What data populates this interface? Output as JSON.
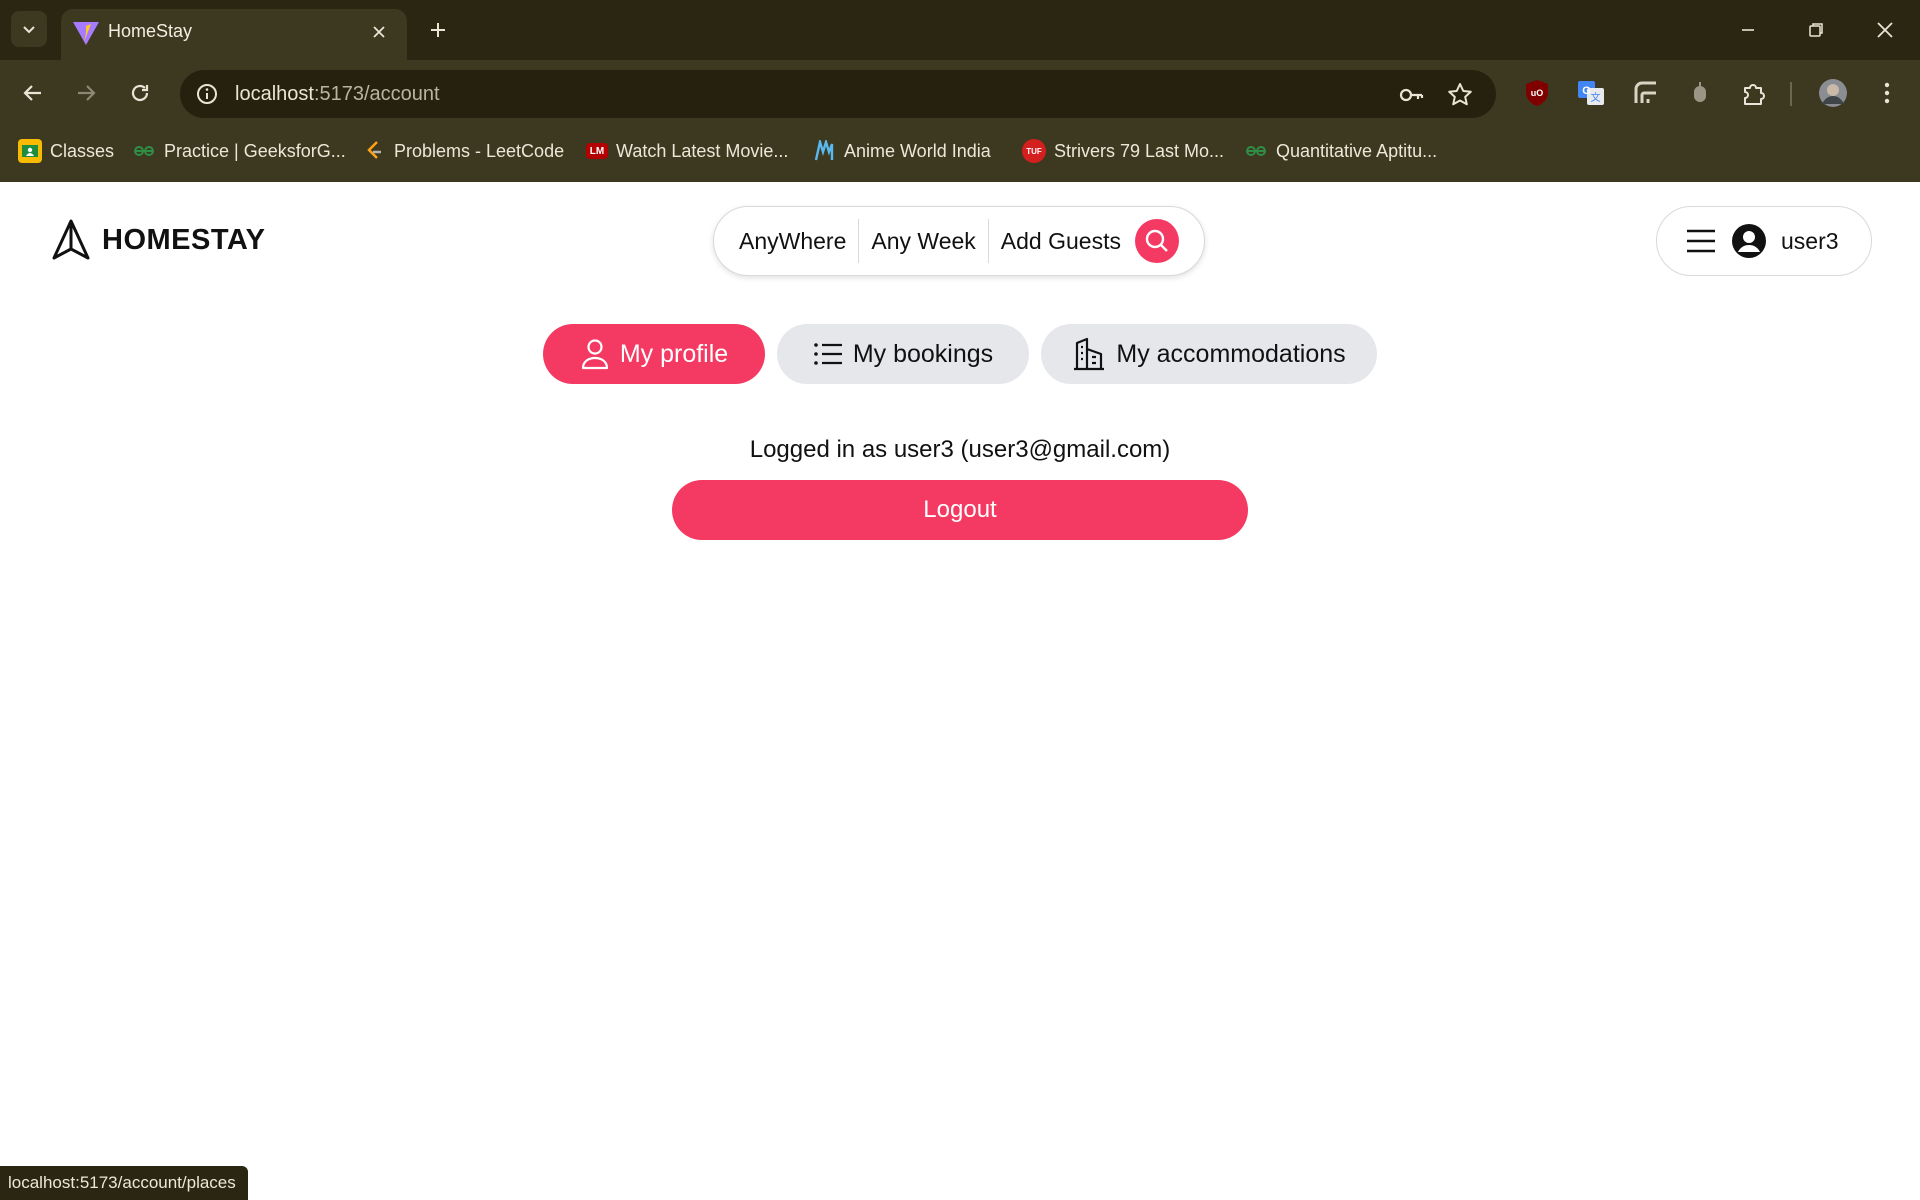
{
  "browser": {
    "tab": {
      "title": "HomeStay"
    },
    "url": {
      "host": "localhost",
      "rest": ":5173/account"
    },
    "bookmarks": [
      {
        "label": "Classes",
        "icon": "classroom-icon"
      },
      {
        "label": "Practice | GeeksforG...",
        "icon": "geeksforgeeks-icon"
      },
      {
        "label": "Problems - LeetCode",
        "icon": "leetcode-icon"
      },
      {
        "label": "Watch Latest Movie...",
        "icon": "movies-icon",
        "badge": "LM"
      },
      {
        "label": "Anime World India",
        "icon": "anime-icon"
      },
      {
        "label": "Strivers 79 Last Mo...",
        "icon": "tuf-icon",
        "badge": "TUF"
      },
      {
        "label": "Quantitative Aptitu...",
        "icon": "geeksforgeeks-icon"
      }
    ],
    "status_url": "localhost:5173/account/places"
  },
  "header": {
    "logo_text": "HOMESTAY",
    "search": {
      "where": "AnyWhere",
      "when": "Any Week",
      "guests": "Add Guests"
    },
    "user": {
      "name": "user3"
    }
  },
  "account": {
    "tabs": [
      {
        "label": "My profile",
        "active": true
      },
      {
        "label": "My bookings",
        "active": false
      },
      {
        "label": "My accommodations",
        "active": false
      }
    ],
    "logged_in_text": "Logged in as user3 (user3@gmail.com)",
    "logout_label": "Logout"
  },
  "colors": {
    "accent": "#f43a62",
    "chrome_dark": "#2a2611",
    "chrome": "#3d3820",
    "inactive_tab": "#e5e7eb"
  }
}
